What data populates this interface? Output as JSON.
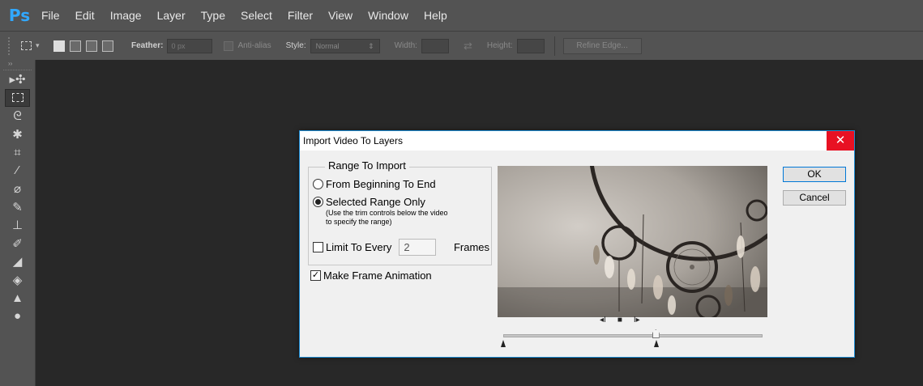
{
  "app": {
    "logo": "Ps"
  },
  "menu": [
    "File",
    "Edit",
    "Image",
    "Layer",
    "Type",
    "Select",
    "Filter",
    "View",
    "Window",
    "Help"
  ],
  "options_bar": {
    "feather_label": "Feather:",
    "feather_value": "0 px",
    "antialias_label": "Anti-alias",
    "style_label": "Style:",
    "style_value": "Normal",
    "width_label": "Width:",
    "height_label": "Height:",
    "refine_edge_label": "Refine Edge..."
  },
  "toolbar_icons": [
    "move-icon",
    "marquee-icon",
    "lasso-icon",
    "quick-selection-icon",
    "crop-icon",
    "eyedropper-icon",
    "healing-brush-icon",
    "brush-icon",
    "clone-stamp-icon",
    "history-brush-icon",
    "eraser-icon",
    "paint-bucket-icon",
    "blur-icon",
    "dodge-icon"
  ],
  "dialog": {
    "title": "Import Video To Layers",
    "close_glyph": "✕",
    "range_group_label": "Range To Import",
    "option_full": "From Beginning To End",
    "option_selected": "Selected Range Only",
    "selected_option": "selected",
    "hint": "(Use the trim controls below the video to specify the range)",
    "limit_label": "Limit To Every",
    "limit_value": "2",
    "limit_checked": false,
    "frames_label": "Frames",
    "make_animation_label": "Make Frame Animation",
    "make_animation_checked": true,
    "ok_label": "OK",
    "cancel_label": "Cancel",
    "trim_playhead_fraction": 0.59,
    "trim_start_fraction": 0.0,
    "trim_end_fraction": 0.59
  }
}
